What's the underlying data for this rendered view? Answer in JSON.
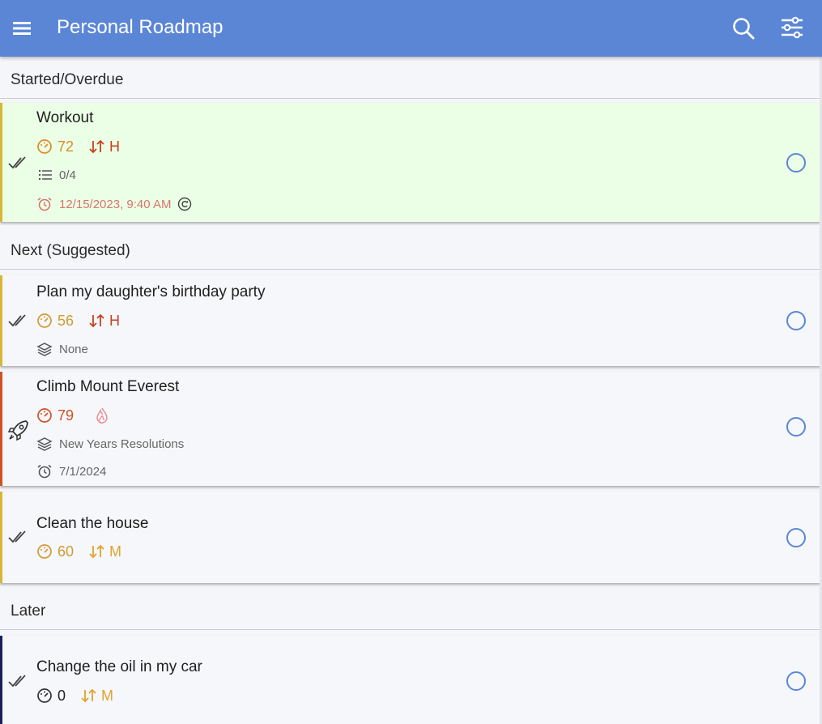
{
  "app": {
    "title": "Personal Roadmap",
    "accent_color": "#5b86d6"
  },
  "toolbar": {
    "menu_icon": "hamburger-menu-icon",
    "search_icon": "search-icon",
    "filter_icon": "filter-sliders-icon"
  },
  "sections": {
    "started": {
      "label": "Started/Overdue"
    },
    "next": {
      "label": "Next (Suggested)"
    },
    "later": {
      "label": "Later"
    }
  },
  "tasks": {
    "workout": {
      "title": "Workout",
      "score": "72",
      "priority": "H",
      "checklist": "0/4",
      "due": "12/15/2023, 9:40 AM"
    },
    "birthday": {
      "title": "Plan my daughter's birthday party",
      "score": "56",
      "priority": "H",
      "group": "None"
    },
    "everest": {
      "title": "Climb Mount Everest",
      "score": "79",
      "group": "New Years Resolutions",
      "due": "7/1/2024"
    },
    "house": {
      "title": "Clean the house",
      "score": "60",
      "priority": "M"
    },
    "oil": {
      "title": "Change the oil in my car",
      "score": "0",
      "priority": "M"
    }
  },
  "colors": {
    "appbar": "#5b86d6",
    "started_background": "#ebffe6",
    "card_background": "#f6f7fb",
    "score_orange": "#de8a27",
    "score_gold": "#d29a32",
    "score_red": "#cf5225",
    "priority_high": "#c8411e",
    "priority_medium": "#e3a12c",
    "overdue_text": "#d9746e"
  }
}
